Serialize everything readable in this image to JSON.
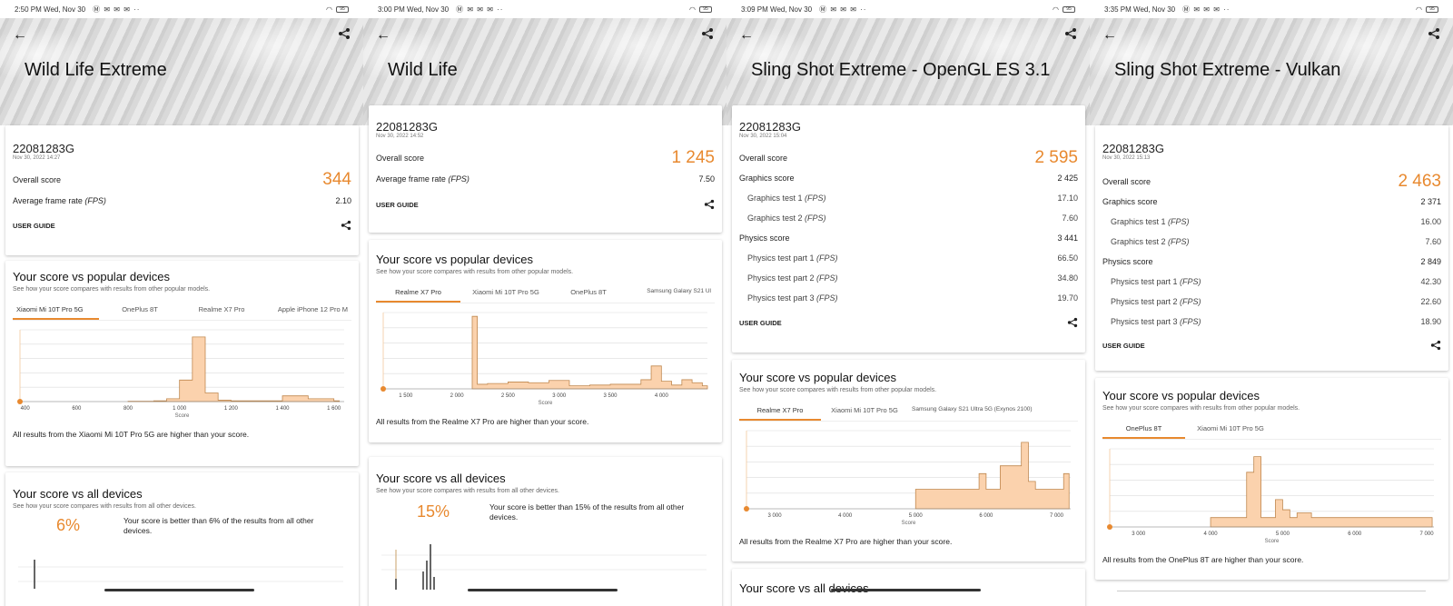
{
  "accent": "#e8892f",
  "status_icons": "Ⓜ ✉ ✉ ✉ ··",
  "panels": [
    {
      "time": "2:50 PM",
      "day": "Wed, Nov 30",
      "battery": "95",
      "title": "Wild Life Extreme",
      "device": "22081283G",
      "date": "Nov 30, 2022 14:27",
      "overall_label": "Overall score",
      "overall_value": "344",
      "avg_label": "Average frame rate",
      "avg_unit": "(FPS)",
      "avg_value": "2.10",
      "user_guide": "USER GUIDE",
      "popular_title": "Your score vs popular devices",
      "popular_desc": "See how your score compares with results from other popular models.",
      "tabs": [
        "Xiaomi Mi 10T Pro 5G",
        "OnePlus 8T",
        "Realme X7 Pro",
        "Apple iPhone 12 Pro M"
      ],
      "chart_note": "All results from the Xiaomi Mi 10T Pro 5G are higher than your score.",
      "all_title": "Your score vs all devices",
      "all_desc": "See how your score compares with results from all other devices.",
      "percent": "6%",
      "percent_desc": "Your score is better than 6% of the results from all other devices."
    },
    {
      "time": "3:00 PM",
      "day": "Wed, Nov 30",
      "battery": "95",
      "title": "Wild Life",
      "device": "22081283G",
      "date": "Nov 30, 2022 14:52",
      "overall_label": "Overall score",
      "overall_value": "1 245",
      "avg_label": "Average frame rate",
      "avg_unit": "(FPS)",
      "avg_value": "7.50",
      "user_guide": "USER GUIDE",
      "popular_title": "Your score vs popular devices",
      "popular_desc": "See how your score compares with results from other popular models.",
      "tabs": [
        "Realme X7 Pro",
        "Xiaomi Mi 10T Pro 5G",
        "OnePlus 8T",
        "Samsung Galaxy S21 Ul"
      ],
      "chart_note": "All results from the Realme X7 Pro are higher than your score.",
      "all_title": "Your score vs all devices",
      "all_desc": "See how your score compares with results from all other devices.",
      "percent": "15%",
      "percent_desc": "Your score is better than 15% of the results from all other devices."
    },
    {
      "time": "3:09 PM",
      "day": "Wed, Nov 30",
      "battery": "95",
      "title": "Sling Shot Extreme - OpenGL ES 3.1",
      "device": "22081283G",
      "date": "Nov 30, 2022 15:04",
      "overall_label": "Overall score",
      "overall_value": "2 595",
      "rows": [
        {
          "label": "Graphics score",
          "unit": "",
          "value": "2 425",
          "sub": false
        },
        {
          "label": "Graphics test 1",
          "unit": "(FPS)",
          "value": "17.10",
          "sub": true
        },
        {
          "label": "Graphics test 2",
          "unit": "(FPS)",
          "value": "7.60",
          "sub": true
        },
        {
          "label": "Physics score",
          "unit": "",
          "value": "3 441",
          "sub": false
        },
        {
          "label": "Physics test part 1",
          "unit": "(FPS)",
          "value": "66.50",
          "sub": true
        },
        {
          "label": "Physics test part 2",
          "unit": "(FPS)",
          "value": "34.80",
          "sub": true
        },
        {
          "label": "Physics test part 3",
          "unit": "(FPS)",
          "value": "19.70",
          "sub": true
        }
      ],
      "user_guide": "USER GUIDE",
      "popular_title": "Your score vs popular devices",
      "popular_desc": "See how your score compares with results from other popular models.",
      "tabs": [
        "Realme X7 Pro",
        "Xiaomi Mi 10T Pro 5G",
        "Samsung Galaxy S21 Ultra 5G (Exynos 2100)"
      ],
      "chart_note": "All results from the Realme X7 Pro are higher than your score.",
      "all_title": "Your score vs all devices"
    },
    {
      "time": "3:35 PM",
      "day": "Wed, Nov 30",
      "battery": "95",
      "title": "Sling Shot Extreme - Vulkan",
      "device": "22081283G",
      "date": "Nov 30, 2022 15:13",
      "overall_label": "Overall score",
      "overall_value": "2 463",
      "rows": [
        {
          "label": "Graphics score",
          "unit": "",
          "value": "2 371",
          "sub": false
        },
        {
          "label": "Graphics test 1",
          "unit": "(FPS)",
          "value": "16.00",
          "sub": true
        },
        {
          "label": "Graphics test 2",
          "unit": "(FPS)",
          "value": "7.60",
          "sub": true
        },
        {
          "label": "Physics score",
          "unit": "",
          "value": "2 849",
          "sub": false
        },
        {
          "label": "Physics test part 1",
          "unit": "(FPS)",
          "value": "42.30",
          "sub": true
        },
        {
          "label": "Physics test part 2",
          "unit": "(FPS)",
          "value": "22.60",
          "sub": true
        },
        {
          "label": "Physics test part 3",
          "unit": "(FPS)",
          "value": "18.90",
          "sub": true
        }
      ],
      "user_guide": "USER GUIDE",
      "popular_title": "Your score vs popular devices",
      "popular_desc": "See how your score compares with results from other popular models.",
      "tabs": [
        "OnePlus 8T",
        "Xiaomi Mi 10T Pro 5G"
      ],
      "chart_note": "All results from the OnePlus 8T are higher than your score."
    }
  ],
  "chart_data": [
    {
      "type": "area",
      "xlabel": "Score",
      "x_ticks": [
        400,
        600,
        800,
        1000,
        1200,
        1400,
        1600
      ],
      "xlim": [
        380,
        1640
      ],
      "x": [
        800,
        900,
        950,
        1000,
        1050,
        1100,
        1150,
        1200,
        1300,
        1400,
        1500,
        1600
      ],
      "y": [
        0.5,
        1,
        4,
        30,
        90,
        12,
        2,
        1,
        1,
        8,
        4,
        1
      ],
      "your_score": 344
    },
    {
      "type": "area",
      "xlabel": "Score",
      "x_ticks": [
        1500,
        2000,
        2500,
        3000,
        3500,
        4000
      ],
      "xlim": [
        1280,
        4450
      ],
      "x": [
        2150,
        2200,
        2300,
        2500,
        2700,
        2900,
        3100,
        3300,
        3500,
        3800,
        3900,
        4000,
        4100,
        4200,
        4300,
        4400
      ],
      "y": [
        95,
        6,
        7,
        9,
        8,
        11,
        4,
        5,
        6,
        12,
        30,
        10,
        5,
        12,
        8,
        4
      ],
      "your_score": 1245
    },
    {
      "type": "area",
      "xlabel": "Score",
      "x_ticks": [
        3000,
        4000,
        5000,
        6000,
        7000
      ],
      "xlim": [
        2600,
        7200
      ],
      "x": [
        5000,
        5800,
        5900,
        6000,
        6200,
        6400,
        6500,
        6600,
        6700,
        6800,
        7000,
        7100
      ],
      "y": [
        25,
        25,
        45,
        25,
        55,
        55,
        85,
        35,
        25,
        25,
        25,
        45
      ],
      "your_score": 2595
    },
    {
      "type": "area",
      "xlabel": "Score",
      "x_ticks": [
        3000,
        4000,
        5000,
        6000,
        7000
      ],
      "xlim": [
        2600,
        7100
      ],
      "x": [
        4000,
        4300,
        4500,
        4600,
        4700,
        4900,
        5000,
        5100,
        5200,
        5400,
        5600,
        7000
      ],
      "y": [
        12,
        12,
        70,
        90,
        12,
        35,
        22,
        12,
        18,
        12,
        12,
        12
      ],
      "your_score": 2463
    }
  ]
}
